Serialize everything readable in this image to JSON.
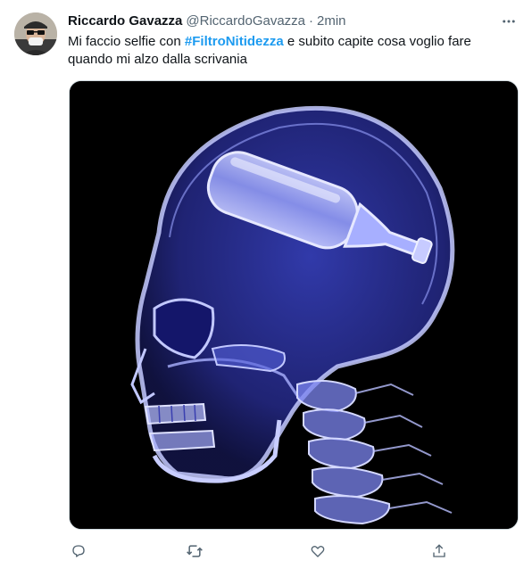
{
  "tweet": {
    "author_name": "Riccardo Gavazza",
    "author_handle": "@RiccardoGavazza",
    "separator": "·",
    "timestamp": "2min",
    "text_before": "Mi faccio selfie con ",
    "hashtag": "#FiltroNitidezza",
    "text_after": " e subito capite cosa voglio fare quando mi alzo dalla scrivania"
  },
  "icons": {
    "more": "more-horizontal-icon",
    "reply": "reply-icon",
    "retweet": "retweet-icon",
    "like": "heart-icon",
    "share": "share-icon"
  },
  "colors": {
    "text": "#0f1419",
    "secondary": "#536471",
    "accent": "#1d9bf0",
    "xray": "#8a96ff"
  }
}
